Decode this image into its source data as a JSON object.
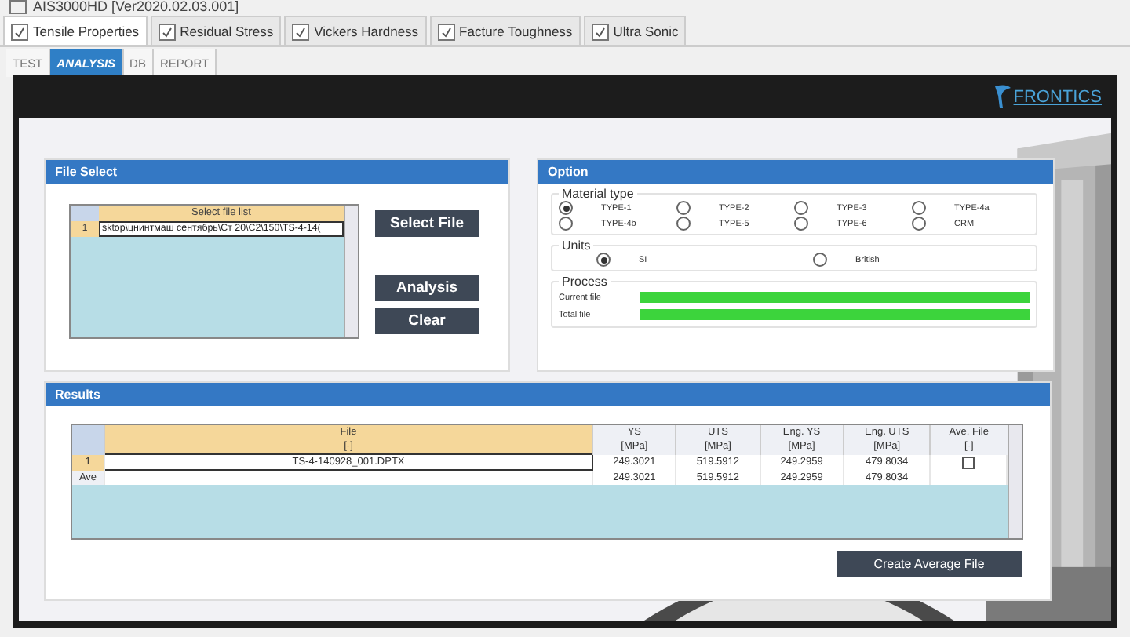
{
  "window": {
    "title": "AIS3000HD [Ver2020.02.03.001]"
  },
  "tabs": [
    {
      "label": "Tensile Properties",
      "selected": true
    },
    {
      "label": "Residual Stress",
      "selected": false
    },
    {
      "label": "Vickers Hardness",
      "selected": false
    },
    {
      "label": "Facture Toughness",
      "selected": false
    },
    {
      "label": "Ultra Sonic",
      "selected": false
    }
  ],
  "subtabs": [
    {
      "label": "TEST",
      "selected": false
    },
    {
      "label": "ANALYSIS",
      "selected": true
    },
    {
      "label": "DB",
      "selected": false
    },
    {
      "label": "REPORT",
      "selected": false
    }
  ],
  "logo": "FRONTICS",
  "file_select": {
    "title": "File Select",
    "list_header": "Select file list",
    "rows": [
      {
        "index": "1",
        "path": "sktop\\цнинтмаш сентябрь\\Ст 20\\С2\\150\\TS-4-14("
      }
    ],
    "buttons": [
      "Select File",
      "Analysis",
      "Clear"
    ]
  },
  "option": {
    "title": "Option",
    "material_title": "Material type",
    "materials": [
      {
        "label": "TYPE-1",
        "selected": true
      },
      {
        "label": "TYPE-2",
        "selected": false
      },
      {
        "label": "TYPE-3",
        "selected": false
      },
      {
        "label": "TYPE-4a",
        "selected": false
      },
      {
        "label": "TYPE-4b",
        "selected": false
      },
      {
        "label": "TYPE-5",
        "selected": false
      },
      {
        "label": "TYPE-6",
        "selected": false
      },
      {
        "label": "CRM",
        "selected": false
      }
    ],
    "units_title": "Units",
    "units": [
      {
        "label": "SI",
        "selected": true
      },
      {
        "label": "British",
        "selected": false
      }
    ],
    "process_title": "Process",
    "progress": [
      {
        "label": "Current file",
        "level": 1
      },
      {
        "label": "Total file",
        "level": 1
      }
    ]
  },
  "results": {
    "title": "Results",
    "columns": [
      {
        "name": "File",
        "unit": "[-]"
      },
      {
        "name": "YS",
        "unit": "[MPa]"
      },
      {
        "name": "UTS",
        "unit": "[MPa]"
      },
      {
        "name": "Eng. YS",
        "unit": "[MPa]"
      },
      {
        "name": "Eng. UTS",
        "unit": "[MPa]"
      },
      {
        "name": "Ave. File",
        "unit": "[-]"
      }
    ],
    "rows": [
      {
        "index": "1",
        "cells": [
          "TS-4-140928_001.DPTX",
          "249.3021",
          "519.5912",
          "249.2959",
          "479.8034"
        ],
        "checked": false
      },
      {
        "index": "Ave",
        "cells": [
          "",
          "249.3021",
          "519.5912",
          "249.2959",
          "479.8034"
        ]
      }
    ],
    "button": "Create Average File"
  }
}
